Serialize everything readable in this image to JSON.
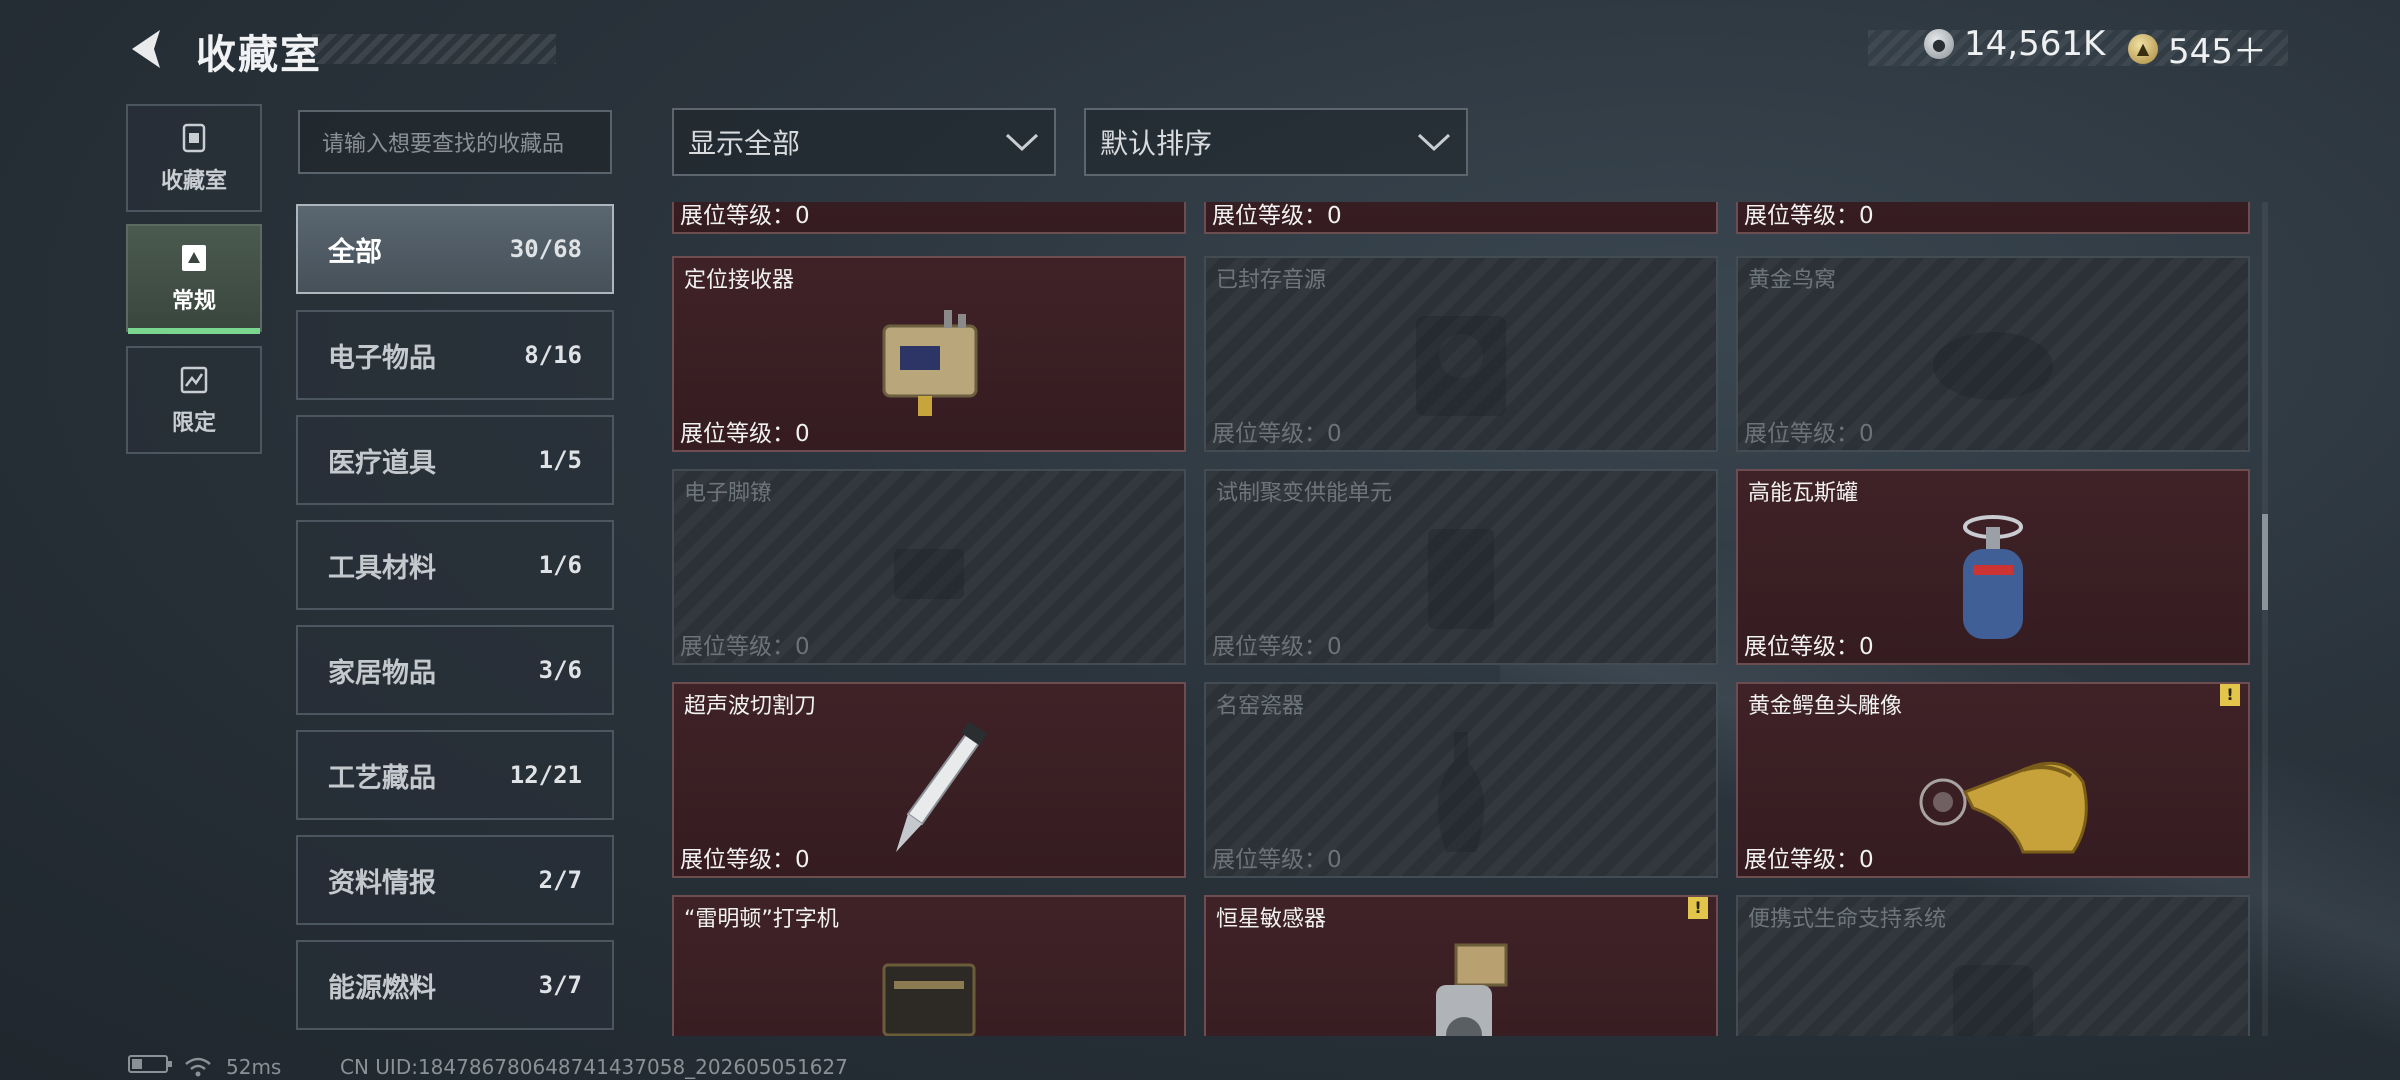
{
  "header": {
    "title": "收藏室",
    "currency": [
      {
        "icon": "silver-coin-icon",
        "value": "14,561K"
      },
      {
        "icon": "gold-coin-icon",
        "value": "545＋"
      }
    ]
  },
  "nav": {
    "tabs": [
      {
        "label": "收藏室",
        "icon": "collection-room-icon",
        "active": false
      },
      {
        "label": "常规",
        "icon": "regular-icon",
        "active": true
      },
      {
        "label": "限定",
        "icon": "limited-icon",
        "active": false
      }
    ]
  },
  "search": {
    "placeholder": "请输入想要查找的收藏品"
  },
  "categories": [
    {
      "label": "全部",
      "count": "30/68",
      "active": true
    },
    {
      "label": "电子物品",
      "count": "8/16"
    },
    {
      "label": "医疗道具",
      "count": "1/5"
    },
    {
      "label": "工具材料",
      "count": "1/6"
    },
    {
      "label": "家居物品",
      "count": "3/6"
    },
    {
      "label": "工艺藏品",
      "count": "12/21"
    },
    {
      "label": "资料情报",
      "count": "2/7"
    },
    {
      "label": "能源燃料",
      "count": "3/7"
    }
  ],
  "filters": {
    "show_label": "显示全部",
    "sort_label": "默认排序"
  },
  "items": {
    "top_row": [
      {
        "level": "展位等级：0"
      },
      {
        "level": "展位等级：0"
      },
      {
        "level": "展位等级：0"
      }
    ],
    "row1": [
      {
        "name": "定位接收器",
        "level": "展位等级：0",
        "owned": true
      },
      {
        "name": "已封存音源",
        "level": "展位等级：0",
        "owned": false
      },
      {
        "name": "黄金鸟窝",
        "level": "展位等级：0",
        "owned": false
      }
    ],
    "row2": [
      {
        "name": "电子脚镣",
        "level": "展位等级：0",
        "owned": false
      },
      {
        "name": "试制聚变供能单元",
        "level": "展位等级：0",
        "owned": false
      },
      {
        "name": "高能瓦斯罐",
        "level": "展位等级：0",
        "owned": true
      }
    ],
    "row3": [
      {
        "name": "超声波切割刀",
        "level": "展位等级：0",
        "owned": true
      },
      {
        "name": "名窑瓷器",
        "level": "展位等级：0",
        "owned": false
      },
      {
        "name": "黄金鳄鱼头雕像",
        "level": "展位等级：0",
        "owned": true,
        "alert": "!"
      }
    ],
    "row4": [
      {
        "name": "“雷明顿”打字机",
        "owned": true
      },
      {
        "name": "恒星敏感器",
        "owned": true,
        "alert": "!"
      },
      {
        "name": "便携式生命支持系统",
        "owned": false
      }
    ]
  },
  "status": {
    "ping": "52ms",
    "uid": "CN UID:1847867806487414370​58_202605051627"
  },
  "colors": {
    "owned_card": "#3f2227",
    "locked_card": "#2b3137",
    "active_tab_underline": "#7bd78f",
    "alert": "#e2c54a"
  }
}
